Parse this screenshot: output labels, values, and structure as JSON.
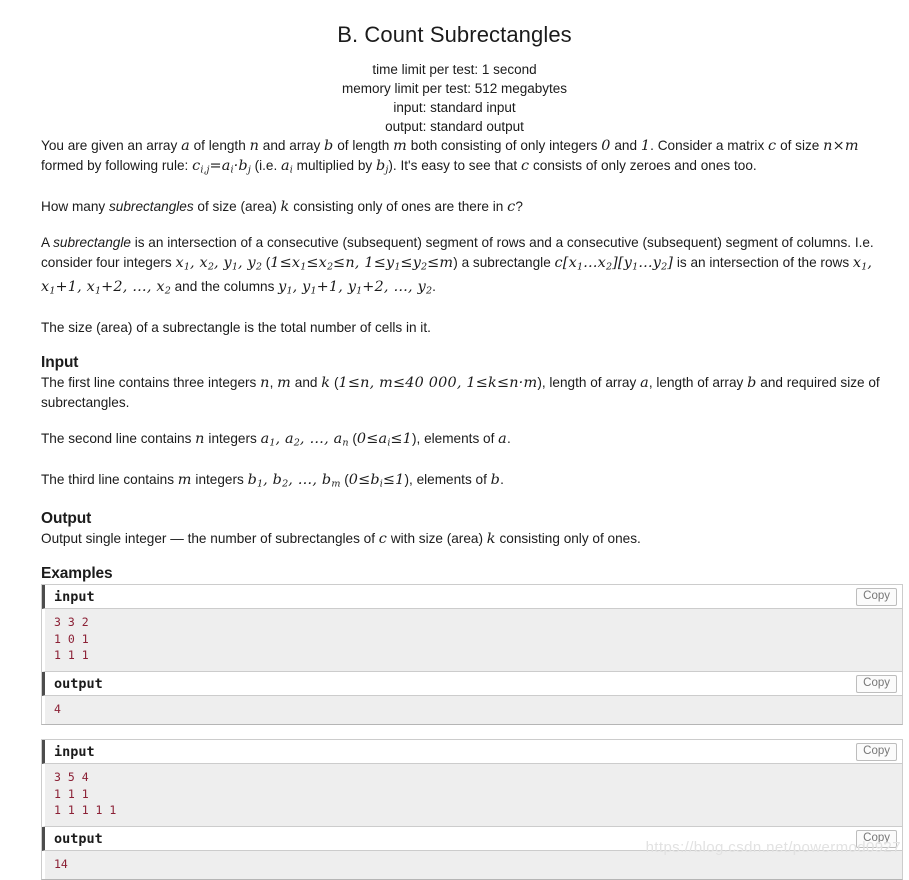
{
  "header": {
    "title": "B. Count Subrectangles",
    "time_limit": "time limit per test: 1 second",
    "memory_limit": "memory limit per test: 512 megabytes",
    "input_spec": "input: standard input",
    "output_spec": "output: standard output"
  },
  "statement": {
    "p1_t1": "You are given an array ",
    "p1_a": "a",
    "p1_t2": " of length ",
    "p1_n": "n",
    "p1_t3": " and array ",
    "p1_b": "b",
    "p1_t4": " of length ",
    "p1_m": "m",
    "p1_t5": " both consisting of only integers ",
    "p1_zero": "0",
    "p1_t6": " and ",
    "p1_one": "1",
    "p1_t7": ". Consider a matrix ",
    "p1_c": "c",
    "p1_t8": " of size ",
    "p1_n2": "n",
    "p1_times": "×",
    "p1_m2": "m",
    "p1_t9": " formed by following rule: ",
    "p1_eq_c": "c",
    "p1_eq_sub": "i,j",
    "p1_eq_eq": "=",
    "p1_eq_a": "a",
    "p1_eq_asub": "i",
    "p1_eq_dot": "·",
    "p1_eq_b": "b",
    "p1_eq_bsub": "j",
    "p1_t10": " (i.e. ",
    "p1_ai": "a",
    "p1_ai_sub": "i",
    "p1_t11": " multiplied by ",
    "p1_bj": "b",
    "p1_bj_sub": "j",
    "p1_t12": "). It's easy to see that ",
    "p1_c2": "c",
    "p1_t13": " consists of only zeroes and ones too.",
    "p2_t1": "How many ",
    "p2_ital": "subrectangles",
    "p2_t2": " of size (area) ",
    "p2_k": "k",
    "p2_t3": " consisting only of ones are there in ",
    "p2_c": "c",
    "p2_t4": "?",
    "p3_t1": "A ",
    "p3_ital": "subrectangle",
    "p3_t2": " is an intersection of a consecutive (subsequent) segment of rows and a consecutive (subsequent) segment of columns. I.e. consider four integers ",
    "p3_x1": "x",
    "p3_x1s": "1",
    "p3_comma1": ", ",
    "p3_x2": "x",
    "p3_x2s": "2",
    "p3_comma2": ", ",
    "p3_y1": "y",
    "p3_y1s": "1",
    "p3_comma3": ", ",
    "p3_y2": "y",
    "p3_y2s": "2",
    "p3_paren_open": " (",
    "p3_one": "1",
    "p3_le1": "≤",
    "p3_cx1": "x",
    "p3_cx1s": "1",
    "p3_le2": "≤",
    "p3_cx2": "x",
    "p3_cx2s": "2",
    "p3_le3": "≤",
    "p3_n": "n",
    "p3_comma4": ", ",
    "p3_one2": "1",
    "p3_le4": "≤",
    "p3_cy1": "y",
    "p3_cy1s": "1",
    "p3_le5": "≤",
    "p3_cy2": "y",
    "p3_cy2s": "2",
    "p3_le6": "≤",
    "p3_m": "m",
    "p3_paren_close": ")",
    "p3_t3": " a subrectangle ",
    "p3_cc": "c",
    "p3_br1": "[",
    "p3_bx1": "x",
    "p3_bx1s": "1",
    "p3_dots1": "…",
    "p3_bx2": "x",
    "p3_bx2s": "2",
    "p3_br2": "]",
    "p3_br3": "[",
    "p3_by1": "y",
    "p3_by1s": "1",
    "p3_dots2": "…",
    "p3_by2": "y",
    "p3_by2s": "2",
    "p3_br4": "]",
    "p3_t4": " is an intersection of the rows ",
    "p3_rx1": "x",
    "p3_rx1s": "1",
    "p3_rcomma1": ", ",
    "p3_rx2": "x",
    "p3_rx2s": "1",
    "p3_plus1": "+",
    "p3_rone": "1",
    "p3_rcomma2": ", ",
    "p3_rx3": "x",
    "p3_rx3s": "1",
    "p3_plus2": "+",
    "p3_rtwo": "2",
    "p3_rcomma3": ", ",
    "p3_rdots": "…",
    "p3_rcomma4": ", ",
    "p3_rx4": "x",
    "p3_rx4s": "2",
    "p3_t5": " and the columns ",
    "p3_cy1b": "y",
    "p3_cy1bs": "1",
    "p3_ccomma1": ", ",
    "p3_cy2b": "y",
    "p3_cy2bs": "1",
    "p3_cplus1": "+",
    "p3_cone": "1",
    "p3_ccomma2": ", ",
    "p3_cy3b": "y",
    "p3_cy3bs": "1",
    "p3_cplus2": "+",
    "p3_ctwo": "2",
    "p3_ccomma3": ", ",
    "p3_cdots": "…",
    "p3_ccomma4": ", ",
    "p3_cy4b": "y",
    "p3_cy4bs": "2",
    "p3_t6": ".",
    "p4": "The size (area) of a subrectangle is the total number of cells in it."
  },
  "input_section": {
    "title": "Input",
    "l1_t1": "The first line contains three integers ",
    "l1_n": "n",
    "l1_c1": ", ",
    "l1_m": "m",
    "l1_t2": " and ",
    "l1_k": "k",
    "l1_t3": " (",
    "l1_one": "1",
    "l1_le1": "≤",
    "l1_n2": "n",
    "l1_c2": ", ",
    "l1_m2": "m",
    "l1_le2": "≤",
    "l1_40000": "40 000",
    "l1_c3": ", ",
    "l1_one2": "1",
    "l1_le3": "≤",
    "l1_k2": "k",
    "l1_le4": "≤",
    "l1_n3": "n",
    "l1_dot": "·",
    "l1_m3": "m",
    "l1_t4": "), length of array ",
    "l1_a": "a",
    "l1_t5": ", length of array ",
    "l1_b": "b",
    "l1_t6": " and required size of subrectangles.",
    "l2_t1": "The second line contains ",
    "l2_n": "n",
    "l2_t2": " integers ",
    "l2_a1": "a",
    "l2_a1s": "1",
    "l2_c1": ", ",
    "l2_a2": "a",
    "l2_a2s": "2",
    "l2_c2": ", ",
    "l2_dots": "…",
    "l2_c3": ", ",
    "l2_an": "a",
    "l2_ans": "n",
    "l2_t3": " (",
    "l2_zero": "0",
    "l2_le1": "≤",
    "l2_ai": "a",
    "l2_ais": "i",
    "l2_le2": "≤",
    "l2_one": "1",
    "l2_t4": "), elements of ",
    "l2_a": "a",
    "l2_t5": ".",
    "l3_t1": "The third line contains ",
    "l3_m": "m",
    "l3_t2": " integers ",
    "l3_b1": "b",
    "l3_b1s": "1",
    "l3_c1": ", ",
    "l3_b2": "b",
    "l3_b2s": "2",
    "l3_c2": ", ",
    "l3_dots": "…",
    "l3_c3": ", ",
    "l3_bm": "b",
    "l3_bms": "m",
    "l3_t3": " (",
    "l3_zero": "0",
    "l3_le1": "≤",
    "l3_bi": "b",
    "l3_bis": "i",
    "l3_le2": "≤",
    "l3_one": "1",
    "l3_t4": "), elements of ",
    "l3_b": "b",
    "l3_t5": "."
  },
  "output_section": {
    "title": "Output",
    "t1": "Output single integer — the number of subrectangles of ",
    "c": "c",
    "t2": " with size (area) ",
    "k": "k",
    "t3": " consisting only of ones."
  },
  "examples": {
    "title": "Examples",
    "copy_label": "Copy",
    "input_label": "input",
    "output_label": "output",
    "items": [
      {
        "input": "3 3 2\n1 0 1\n1 1 1",
        "output": "4"
      },
      {
        "input": "3 5 4\n1 1 1\n1 1 1 1 1",
        "output": "14"
      }
    ]
  },
  "watermark": "https://blog.csdn.net/powermod0927"
}
